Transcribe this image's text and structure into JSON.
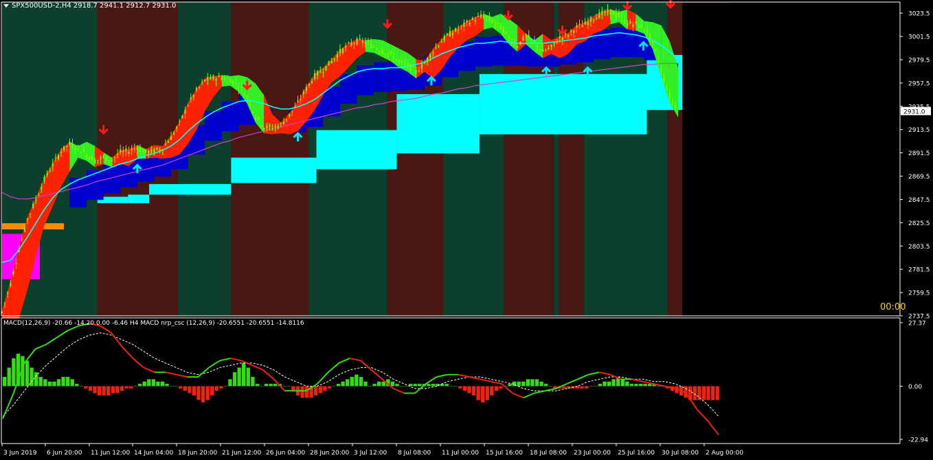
{
  "header": {
    "symbol_caption": "SPX500USD-2,H4  2918.7 2941.1 2912.7 2931.0",
    "macd_caption": "MACD(12,26,9) -20.66 -14.20 0.00 -6.46  H4 MACD nrp_csc (12,26,9) -20.6551 -20.6551 -14.8116",
    "timer": "00:00"
  },
  "colors": {
    "background": "#000000",
    "bull_zone": "#0c3f2c",
    "bear_zone": "#4a1812",
    "candle": "#7cfc00",
    "ema_fast": "#00ffff",
    "ema_slow": "#cc44cc",
    "cloud_blue": "#0000cd",
    "cloud_cyan": "#00ffff",
    "band_up": "#ff2200",
    "band_down": "#33ee22",
    "macd_pos": "#33dd11",
    "macd_neg": "#ee2211",
    "arrow_up": "#00e5ff",
    "arrow_down": "#ff1a1a",
    "price_label_bg": "#ffffff"
  },
  "chart_data": [
    {
      "type": "candlestick",
      "title": "SPX500USD-2,H4",
      "ohlc_last": {
        "open": 2918.7,
        "high": 2941.1,
        "low": 2912.7,
        "close": 2931.0
      },
      "current_price_label": "2931.0",
      "y_ticks": [
        "3023.5",
        "3001.5",
        "2979.5",
        "2957.5",
        "2935.5",
        "2913.5",
        "2891.5",
        "2869.5",
        "2847.5",
        "2825.5",
        "2803.5",
        "2781.5",
        "2759.5",
        "2737.5"
      ],
      "x_ticks": [
        "3 Jun 2019",
        "6 Jun 20:00",
        "11 Jun 12:00",
        "14 Jun 04:00",
        "18 Jun 20:00",
        "21 Jun 12:00",
        "26 Jun 04:00",
        "28 Jun 20:00",
        "3 Jul 12:00",
        "8 Jul 08:00",
        "11 Jul 00:00",
        "15 Jul 16:00",
        "18 Jul 08:00",
        "23 Jul 00:00",
        "25 Jul 16:00",
        "30 Jul 08:00",
        "2 Aug 00:00"
      ],
      "ylim": [
        2737.5,
        3034
      ],
      "price_path": [
        2741,
        2768,
        2800,
        2829,
        2847,
        2866,
        2880,
        2893,
        2900,
        2896,
        2890,
        2884,
        2887,
        2885,
        2892,
        2893,
        2897,
        2892,
        2893,
        2896,
        2906,
        2919,
        2937,
        2950,
        2960,
        2962,
        2963,
        2961,
        2955,
        2944,
        2926,
        2916,
        2915,
        2918,
        2927,
        2938,
        2952,
        2964,
        2970,
        2978,
        2987,
        2993,
        2997,
        2996,
        2992,
        2988,
        2984,
        2978,
        2974,
        2968,
        2976,
        2988,
        2997,
        3004,
        3008,
        3014,
        3018,
        3021,
        3016,
        3010,
        3000,
        2993,
        3002,
        2996,
        2987,
        2991,
        3000,
        3003,
        3010,
        3013,
        3019,
        3023,
        3025,
        3021,
        3014,
        3013,
        3010,
        2995,
        2970,
        2945,
        2931
      ],
      "ema_fast": [
        2788,
        2790,
        2800,
        2812,
        2825,
        2838,
        2849,
        2857,
        2862,
        2866,
        2869,
        2872,
        2875,
        2878,
        2881,
        2883,
        2886,
        2889,
        2891,
        2894,
        2898,
        2904,
        2912,
        2919,
        2925,
        2930,
        2934,
        2937,
        2940,
        2941,
        2940,
        2938,
        2935,
        2933,
        2933,
        2935,
        2938,
        2942,
        2948,
        2954,
        2960,
        2964,
        2968,
        2970,
        2971,
        2971,
        2972,
        2972,
        2973,
        2975,
        2977,
        2981,
        2985,
        2988,
        2991,
        2993,
        2995,
        2995,
        2996,
        2997,
        2996,
        2995,
        2995,
        2995,
        2995,
        2996,
        2997,
        2998,
        2999,
        3000,
        3002,
        3003,
        3004,
        3005,
        3004,
        3003,
        3001,
        2998,
        2993,
        2987,
        2980
      ],
      "ema_slow": [
        2854,
        2850,
        2848,
        2848,
        2849,
        2851,
        2853,
        2855,
        2857,
        2859,
        2861,
        2864,
        2866,
        2868,
        2870,
        2872,
        2874,
        2876,
        2878,
        2880,
        2883,
        2886,
        2889,
        2892,
        2895,
        2898,
        2901,
        2903,
        2906,
        2908,
        2910,
        2912,
        2914,
        2916,
        2918,
        2920,
        2922,
        2924,
        2926,
        2928,
        2930,
        2932,
        2934,
        2935,
        2937,
        2938,
        2940,
        2941,
        2942,
        2943,
        2945,
        2947,
        2948,
        2950,
        2952,
        2953,
        2955,
        2956,
        2957,
        2958,
        2959,
        2960,
        2961,
        2962,
        2963,
        2964,
        2965,
        2966,
        2967,
        2968,
        2969,
        2970,
        2971,
        2972,
        2973,
        2974,
        2975,
        2975,
        2976,
        2976,
        2976
      ],
      "zones": [
        {
          "kind": "bull",
          "from": 0,
          "to": 11.3
        },
        {
          "kind": "bear",
          "from": 11.3,
          "to": 20.8
        },
        {
          "kind": "bull",
          "from": 20.8,
          "to": 27.1
        },
        {
          "kind": "bear",
          "from": 27.1,
          "to": 36.3
        },
        {
          "kind": "bull",
          "from": 36.3,
          "to": 45.6
        },
        {
          "kind": "bear",
          "from": 45.6,
          "to": 52.2
        },
        {
          "kind": "bull",
          "from": 52.2,
          "to": 59.4
        },
        {
          "kind": "bear",
          "from": 59.4,
          "to": 65.3
        },
        {
          "kind": "bull",
          "from": 65.3,
          "to": 65.9
        },
        {
          "kind": "bear",
          "from": 65.9,
          "to": 68.8
        },
        {
          "kind": "bull",
          "from": 68.8,
          "to": 78.7
        },
        {
          "kind": "bear",
          "from": 78.7,
          "to": 86.2
        }
      ],
      "cyan_steps": [
        {
          "from": 11.3,
          "to": 14.9,
          "top": 2850,
          "bottom": 2844
        },
        {
          "from": 14.9,
          "to": 17.4,
          "top": 2852,
          "bottom": 2844
        },
        {
          "from": 17.4,
          "to": 27.1,
          "top": 2862,
          "bottom": 2852
        },
        {
          "from": 27.1,
          "to": 37.2,
          "top": 2887,
          "bottom": 2863
        },
        {
          "from": 37.2,
          "to": 46.7,
          "top": 2913,
          "bottom": 2876
        },
        {
          "from": 46.7,
          "to": 56.5,
          "top": 2947,
          "bottom": 2891
        },
        {
          "from": 56.5,
          "to": 76.3,
          "top": 2966,
          "bottom": 2909
        },
        {
          "from": 76.3,
          "to": 86.2,
          "top": 2984,
          "bottom": 2932
        }
      ],
      "arrows": [
        {
          "dir": "down",
          "i": 12,
          "price": 2910
        },
        {
          "dir": "up",
          "i": 16,
          "price": 2880
        },
        {
          "dir": "down",
          "i": 29,
          "price": 2952
        },
        {
          "dir": "up",
          "i": 35,
          "price": 2910
        },
        {
          "dir": "down",
          "i": 45.6,
          "price": 3010
        },
        {
          "dir": "up",
          "i": 50.8,
          "price": 2963
        },
        {
          "dir": "down",
          "i": 59.9,
          "price": 3018
        },
        {
          "dir": "up",
          "i": 64.4,
          "price": 2972
        },
        {
          "dir": "down",
          "i": 66.3,
          "price": 3004
        },
        {
          "dir": "up",
          "i": 69.3,
          "price": 2972
        },
        {
          "dir": "down",
          "i": 74,
          "price": 3027
        },
        {
          "dir": "up",
          "i": 75.9,
          "price": 2996
        },
        {
          "dir": "down",
          "i": 79.1,
          "price": 3029
        },
        {
          "dir": "down",
          "i": 84,
          "price": 3019
        }
      ]
    },
    {
      "type": "bar",
      "title": "MACD(12,26,9)",
      "ylim": [
        -22.94,
        27.37
      ],
      "y_ticks": [
        "27.37",
        "0.00",
        "-22.94"
      ],
      "histogram": [
        4,
        8,
        12,
        14,
        13,
        11,
        8,
        6,
        4,
        3,
        2,
        2,
        3,
        4,
        4,
        3,
        1,
        0,
        -1,
        -2,
        -3,
        -4,
        -4,
        -4,
        -3,
        -3,
        -2,
        -1,
        -1,
        0,
        1,
        2,
        3,
        3,
        2,
        2,
        1,
        0,
        0,
        -1,
        -2,
        -3,
        -4,
        -6,
        -7,
        -6,
        -4,
        -2,
        -1,
        0,
        3,
        6,
        8,
        10,
        8,
        4,
        1,
        0,
        1,
        1,
        1,
        1,
        0,
        0,
        -2,
        -4,
        -5,
        -5,
        -5,
        -4,
        -3,
        -2,
        -1,
        0,
        1,
        2,
        3,
        4,
        5,
        4,
        2,
        0,
        1,
        2,
        2,
        3,
        2,
        1,
        0,
        0,
        1,
        1,
        1,
        1,
        1,
        1,
        1,
        1,
        1,
        0,
        0,
        -1,
        -2,
        -3,
        -4,
        -6,
        -7,
        -6,
        -4,
        -2,
        -1,
        0,
        1,
        2,
        2,
        2,
        3,
        3,
        3,
        2,
        1,
        0,
        -1,
        -1,
        -1,
        -1,
        -1,
        -1,
        -1,
        -1,
        0,
        0,
        1,
        2,
        2,
        3,
        4,
        3,
        2,
        1,
        1,
        1,
        1,
        1,
        1,
        0,
        0,
        -1,
        -2,
        -3,
        -4,
        -5,
        -6,
        -6,
        -6,
        -6,
        -6,
        -6,
        -6
      ],
      "macd_line": [
        -14,
        -3,
        10,
        16,
        18,
        21,
        24,
        26,
        27,
        26,
        23,
        17,
        12,
        8,
        6,
        6,
        5,
        4,
        4,
        8,
        11,
        12,
        11,
        9,
        7,
        3,
        -2,
        -2,
        -2,
        1,
        6,
        10,
        12,
        11,
        7,
        3,
        -1,
        -3,
        -3,
        1,
        4,
        5,
        5,
        4,
        3,
        2,
        1,
        -3,
        -5,
        -3,
        -2,
        -1,
        1,
        3,
        5,
        6,
        5,
        3,
        3,
        2,
        1,
        0,
        -1,
        -3,
        -10,
        -15,
        -21
      ],
      "signal_line": [
        -13,
        -8,
        -2,
        4,
        9,
        13,
        17,
        20,
        22,
        23,
        22,
        20,
        18,
        15,
        12,
        10,
        8,
        6,
        5,
        6,
        8,
        9,
        10,
        10,
        9,
        7,
        4,
        2,
        0,
        0,
        2,
        5,
        7,
        8,
        8,
        6,
        3,
        1,
        -1,
        -1,
        0,
        2,
        3,
        4,
        4,
        3,
        2,
        1,
        -1,
        -2,
        -2,
        -2,
        -1,
        0,
        2,
        3,
        4,
        4,
        3,
        3,
        2,
        2,
        1,
        -1,
        -4,
        -8,
        -13
      ]
    }
  ]
}
